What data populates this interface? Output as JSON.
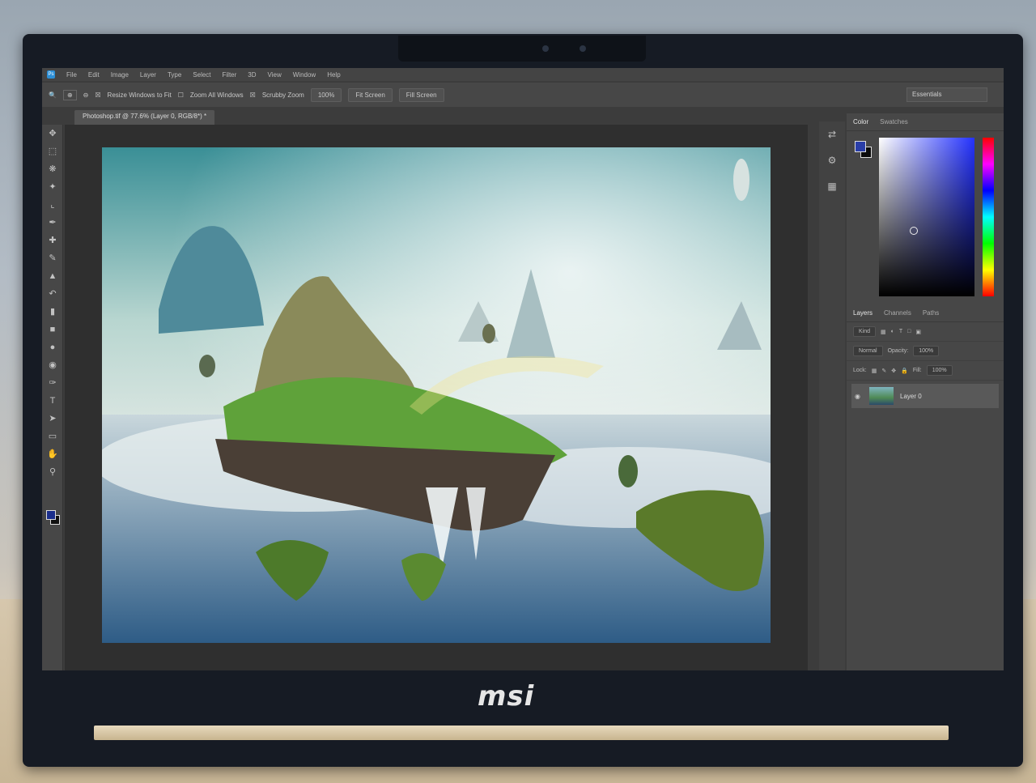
{
  "menubar": {
    "items": [
      "File",
      "Edit",
      "Image",
      "Layer",
      "Type",
      "Select",
      "Filter",
      "3D",
      "View",
      "Window",
      "Help"
    ]
  },
  "options_bar": {
    "resize_label": "Resize Windows to Fit",
    "zoom_all_label": "Zoom All Windows",
    "scrubby_label": "Scrubby Zoom",
    "zoom_100": "100%",
    "fit_screen": "Fit Screen",
    "fill_screen": "Fill Screen",
    "workspace": "Essentials"
  },
  "document": {
    "tab_title": "Photoshop.tif @ 77.6% (Layer 0, RGB/8*) *"
  },
  "tools": {
    "icons": [
      "move-icon",
      "marquee-icon",
      "lasso-icon",
      "quick-select-icon",
      "crop-icon",
      "eyedropper-icon",
      "healing-icon",
      "brush-icon",
      "clone-stamp-icon",
      "history-brush-icon",
      "eraser-icon",
      "gradient-icon",
      "blur-icon",
      "dodge-icon",
      "pen-icon",
      "type-icon",
      "path-select-icon",
      "shape-icon",
      "hand-icon",
      "zoom-icon"
    ]
  },
  "panels": {
    "color_tabs": [
      "Color",
      "Swatches"
    ],
    "layers_tabs": [
      "Layers",
      "Channels",
      "Paths"
    ],
    "kind_label": "Kind",
    "blend_mode": "Normal",
    "opacity_label": "Opacity:",
    "opacity_value": "100%",
    "lock_label": "Lock:",
    "fill_label": "Fill:",
    "fill_value": "100%",
    "layer_name": "Layer 0"
  },
  "colors": {
    "foreground": "#2a3ea8",
    "background": "#0a0a0a"
  },
  "brand": "msi"
}
